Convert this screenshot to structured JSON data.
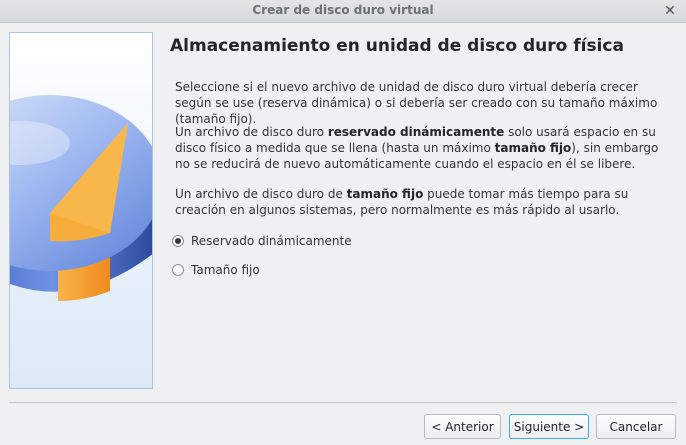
{
  "window": {
    "title": "Crear de disco duro virtual"
  },
  "page": {
    "heading": "Almacenamiento en unidad de disco duro física",
    "para1": "Seleccione si el nuevo archivo de unidad de disco duro virtual debería crecer según se use (reserva dinámica) o si debería ser creado con su tamaño máximo (tamaño fijo).",
    "para2": {
      "a": "Un archivo de disco duro ",
      "b": "reservado dinámicamente",
      "c": " solo usará espacio en su disco físico a medida que se llena (hasta un máximo ",
      "d": "tamaño fijo",
      "e": "), sin embargo no se reducirá de nuevo automáticamente cuando el espacio en él se libere."
    },
    "para3": {
      "a": "Un archivo de disco duro de ",
      "b": "tamaño fijo",
      "c": " puede tomar más tiempo para su creación en algunos sistemas, pero normalmente es más rápido al usarlo."
    }
  },
  "options": [
    {
      "label": "Reservado dinámicamente",
      "selected": true
    },
    {
      "label": "Tamaño fijo",
      "selected": false
    }
  ],
  "buttons": {
    "back": "< Anterior",
    "next": "Siguiente >",
    "cancel": "Cancelar"
  },
  "icons": {
    "close": "close-icon",
    "illustration": "hard-disk-illustration"
  }
}
